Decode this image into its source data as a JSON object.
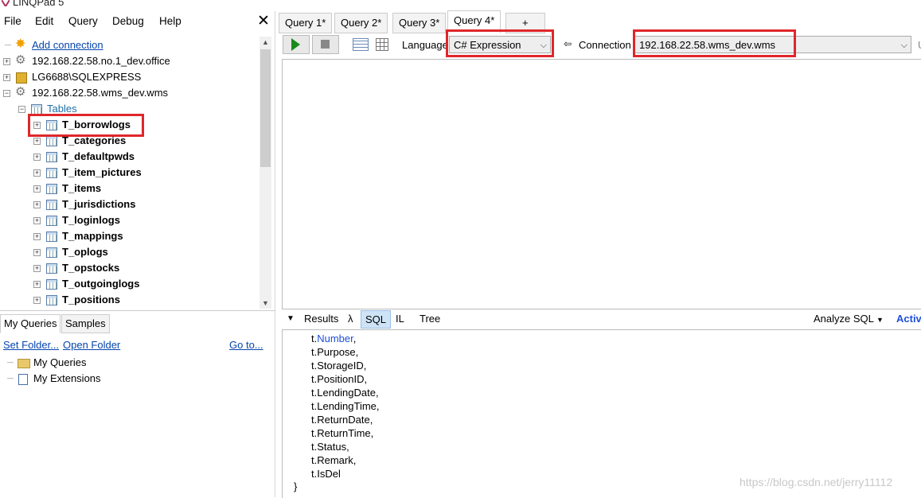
{
  "app": {
    "title": "LINQPad 5"
  },
  "menu": [
    "File",
    "Edit",
    "Query",
    "Debug",
    "Help"
  ],
  "tree": {
    "add_connection": "Add connection",
    "connections": [
      "192.168.22.58.no.1_dev.office",
      "LG6688\\SQLEXPRESS",
      "192.168.22.58.wms_dev.wms"
    ],
    "tables_label": "Tables",
    "tables": [
      "T_borrowlogs",
      "T_categories",
      "T_defaultpwds",
      "T_item_pictures",
      "T_items",
      "T_jurisdictions",
      "T_loginlogs",
      "T_mappings",
      "T_oplogs",
      "T_opstocks",
      "T_outgoinglogs",
      "T_positions"
    ]
  },
  "bottom_left": {
    "tabs": [
      "My Queries",
      "Samples"
    ],
    "links": {
      "set_folder": "Set Folder...",
      "open_folder": "Open Folder",
      "go_to": "Go to..."
    },
    "items": [
      "My Queries",
      "My Extensions"
    ]
  },
  "query_tabs": [
    "Query 1*",
    "Query 2*",
    "Query 3*",
    "Query 4*",
    "+"
  ],
  "toolbar": {
    "language_label": "Language",
    "language_value": "C# Expression",
    "connection_label": "Connection",
    "connection_value": "192.168.22.58.wms_dev.wms",
    "trailing_label": "U"
  },
  "results_tabs": [
    "Results",
    "λ",
    "SQL",
    "IL",
    "Tree"
  ],
  "results_right": {
    "analyze": "Analyze SQL",
    "active": "Activ"
  },
  "code_lines": [
    {
      "prefix": "t.",
      "member": "Number",
      "suffix": ",",
      "highlight": true
    },
    {
      "prefix": "t.",
      "member": "Purpose",
      "suffix": ",",
      "highlight": false
    },
    {
      "prefix": "t.",
      "member": "StorageID",
      "suffix": ",",
      "highlight": false
    },
    {
      "prefix": "t.",
      "member": "PositionID",
      "suffix": ",",
      "highlight": false
    },
    {
      "prefix": "t.",
      "member": "LendingDate",
      "suffix": ",",
      "highlight": false
    },
    {
      "prefix": "t.",
      "member": "LendingTime",
      "suffix": ",",
      "highlight": false
    },
    {
      "prefix": "t.",
      "member": "ReturnDate",
      "suffix": ",",
      "highlight": false
    },
    {
      "prefix": "t.",
      "member": "ReturnTime",
      "suffix": ",",
      "highlight": false
    },
    {
      "prefix": "t.",
      "member": "Status",
      "suffix": ",",
      "highlight": false
    },
    {
      "prefix": "t.",
      "member": "Remark",
      "suffix": ",",
      "highlight": false
    },
    {
      "prefix": "t.",
      "member": "IsDel",
      "suffix": "",
      "highlight": false
    }
  ],
  "code_closing": "}",
  "watermark": "https://blog.csdn.net/jerry11112",
  "colors": {
    "highlight_box": "#e0262b",
    "link": "#0645ad",
    "keyword": "#1f4fd8"
  }
}
